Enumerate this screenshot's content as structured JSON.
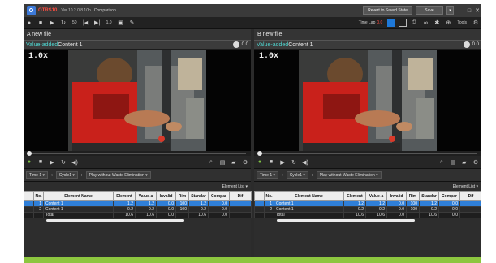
{
  "app": {
    "name": "OTRS10",
    "version": "Ver.10.2.0.8 10b",
    "mode": "Comparison",
    "revert_label": "Revert to Saved State",
    "save_label": "Save",
    "minimize": "–",
    "maximize": "□",
    "close": "✕"
  },
  "toolbar": {
    "timelap_label": "Time Lap",
    "timelap_value": "0.0",
    "zoom_value": "50",
    "speed_value": "1.0",
    "tools_label": "Tools"
  },
  "panels": [
    {
      "title": "A  new file",
      "value_added_label": "Value-added",
      "content_label": "Content 1",
      "time_value": "0.0",
      "speed_badge": "1.0x",
      "filter": {
        "dropdown1": "Time 1",
        "cycle_label": "Cycle1",
        "play_mode": "Play without Waste Elimination"
      },
      "element_list_label": "Element List",
      "table": {
        "headers": [
          "",
          "No.",
          "Element Name",
          "Element",
          "Value-a",
          "Invalid",
          "Rim",
          "Standar",
          "Compar",
          "Dif"
        ],
        "rows": [
          {
            "no": "1",
            "name": "Content 1",
            "vals": [
              "1.2",
              "1.2",
              "0.0",
              "100",
              "1.2",
              "0.0",
              ""
            ]
          },
          {
            "no": "2",
            "name": "Content 1",
            "vals": [
              "0.2",
              "0.2",
              "0.0",
              "100",
              "0.2",
              "0.0",
              ""
            ]
          },
          {
            "no": "",
            "name": "Total",
            "vals": [
              "10.6",
              "10.6",
              "0.0",
              "",
              "10.6",
              "0.0",
              ""
            ]
          }
        ]
      }
    },
    {
      "title": "B  new file",
      "value_added_label": "Value-added",
      "content_label": "Content 1",
      "time_value": "0.0",
      "speed_badge": "1.0x",
      "filter": {
        "dropdown1": "Time 1",
        "cycle_label": "Cycle1",
        "play_mode": "Play without Waste Elimination"
      },
      "element_list_label": "Element List",
      "table": {
        "headers": [
          "",
          "No.",
          "Element Name",
          "Element",
          "Value-a",
          "Invalid",
          "Rim",
          "Standar",
          "Compar",
          "Dif"
        ],
        "rows": [
          {
            "no": "1",
            "name": "Content 1",
            "vals": [
              "1.2",
              "1.2",
              "0.0",
              "100",
              "1.2",
              "0.0",
              ""
            ]
          },
          {
            "no": "2",
            "name": "Content 1",
            "vals": [
              "0.2",
              "0.2",
              "0.0",
              "100",
              "0.2",
              "0.0",
              ""
            ]
          },
          {
            "no": "",
            "name": "Total",
            "vals": [
              "10.6",
              "10.6",
              "0.0",
              "",
              "10.6",
              "0.0",
              ""
            ]
          }
        ]
      }
    }
  ],
  "colors": {
    "accent_blue": "#2f7fd8",
    "brand_red": "#ff4d40",
    "value_added_teal": "#4fd6d0",
    "footer_green": "#8cc63f"
  }
}
